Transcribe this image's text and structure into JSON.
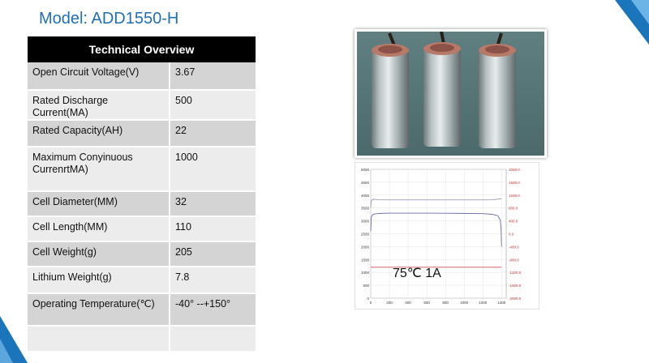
{
  "title": "Model: ADD1550-H",
  "table": {
    "header": "Technical  Overview",
    "rows": [
      {
        "label": "Open Circuit Voltage(V)",
        "value": "3.67"
      },
      {
        "label": "Rated Discharge Current(MA)",
        "value": "500"
      },
      {
        "label": "Rated Capacity(AH)",
        "value": "22"
      },
      {
        "label": "Maximum Conyinuous CurrenrtMA)",
        "value": "1000"
      },
      {
        "label": "Cell Diameter(MM)",
        "value": "32"
      },
      {
        "label": "Cell Length(MM)",
        "value": "110"
      },
      {
        "label": "Cell Weight(g)",
        "value": "205"
      },
      {
        "label": "Lithium Weight(g)",
        "value": "7.8"
      },
      {
        "label": "Operating Temperature(℃)",
        "value": "-40°  --+150°"
      },
      {
        "label": "",
        "value": ""
      }
    ]
  },
  "colors": {
    "title": "#1f6fb5",
    "accent_corner": "#1b75bb",
    "row_dark": "#d4d4d4",
    "row_light": "#ececec",
    "voltage_series": "#9a9ab4",
    "reference_line": "#d05050"
  },
  "chart_data": {
    "type": "line",
    "annotation": "75℃  1A",
    "x_ticks": [
      "0",
      "200",
      "400",
      "600",
      "800",
      "1000",
      "1200",
      "1400"
    ],
    "y_left_ticks": [
      "0",
      "500",
      "1000",
      "1500",
      "2000",
      "2500",
      "3000",
      "3500",
      "4000",
      "4500",
      "5000"
    ],
    "y_right_ticks": [
      "2000.0",
      "1600.0",
      "1200.0",
      "800.0",
      "400.0",
      "0.0",
      "-400.0",
      "-800.0",
      "-1200.0",
      "-1600.0",
      "-2000.0"
    ],
    "xlim": [
      0,
      1450
    ],
    "ylim": [
      0,
      5000
    ],
    "grid": true,
    "series": [
      {
        "x": [
          0,
          5,
          15,
          30,
          60,
          100,
          200,
          400,
          600,
          800,
          1000,
          1200,
          1300,
          1400
        ],
        "values": [
          3500,
          3760,
          3820,
          3840,
          3830,
          3820,
          3815,
          3815,
          3815,
          3815,
          3815,
          3815,
          3820,
          3860
        ]
      },
      {
        "x": [
          0,
          5,
          15,
          30,
          60,
          100,
          200,
          400,
          600,
          800,
          1000,
          1200,
          1300,
          1360,
          1385,
          1395,
          1400
        ],
        "values": [
          2600,
          3120,
          3220,
          3260,
          3275,
          3290,
          3300,
          3300,
          3300,
          3295,
          3290,
          3280,
          3255,
          3200,
          3050,
          2700,
          2000
        ]
      },
      {
        "x": [
          0,
          1400
        ],
        "values": [
          1200,
          1200
        ]
      }
    ]
  }
}
